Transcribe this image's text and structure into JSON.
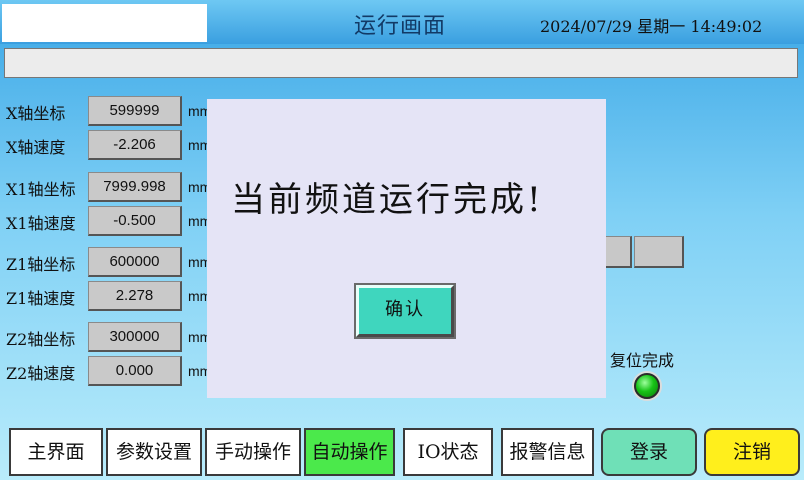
{
  "header": {
    "title": "运行画面",
    "datetime": "2024/07/29 星期一 14:49:02"
  },
  "message_bar": {
    "text": ""
  },
  "axes": [
    {
      "label": "X轴坐标",
      "value": "599999",
      "unit": "mm"
    },
    {
      "label": "X轴速度",
      "value": "-2.206",
      "unit": "mm"
    },
    {
      "label": "X1轴坐标",
      "value": "7999.998",
      "unit": "mm"
    },
    {
      "label": "X1轴速度",
      "value": "-0.500",
      "unit": "mm"
    },
    {
      "label": "Z1轴坐标",
      "value": "600000",
      "unit": "mm"
    },
    {
      "label": "Z1轴速度",
      "value": "2.278",
      "unit": "mm"
    },
    {
      "label": "Z2轴坐标",
      "value": "300000",
      "unit": "mm"
    },
    {
      "label": "Z2轴速度",
      "value": "0.000",
      "unit": "mm"
    }
  ],
  "reset": {
    "label": "复位完成",
    "led_color": "#17c317"
  },
  "dialog": {
    "message": "当前频道运行完成!",
    "confirm_label": "确认"
  },
  "nav": {
    "main": "主界面",
    "params": "参数设置",
    "manual": "手动操作",
    "auto": "自动操作",
    "io": "IO状态",
    "alarm": "报警信息",
    "login": "登录",
    "logout": "注销"
  },
  "colors": {
    "active_nav": "#4be94b",
    "login": "#6fe0b7",
    "logout": "#ffef1c",
    "confirm": "#3fd6be",
    "dialog_bg": "#e5e4f6"
  }
}
